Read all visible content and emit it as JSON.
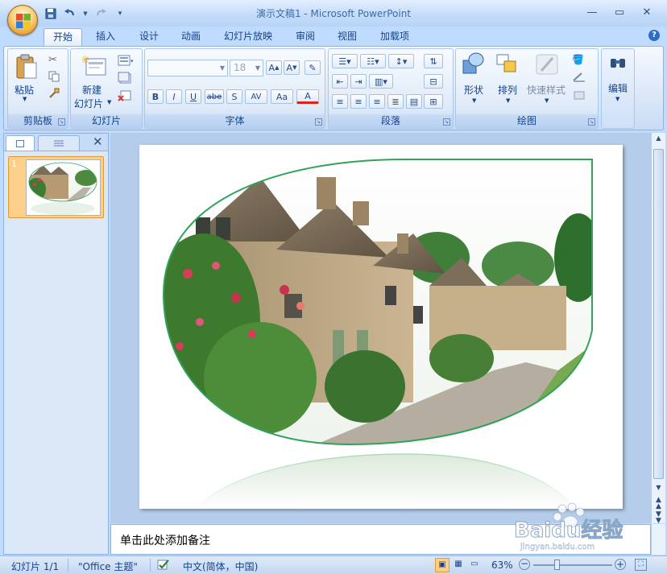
{
  "window": {
    "title": "演示文稿1 - Microsoft PowerPoint"
  },
  "quick_access": {
    "icons": [
      "save-icon",
      "undo-icon",
      "redo-icon",
      "customize-icon"
    ]
  },
  "tabs": [
    {
      "label": "开始",
      "active": true
    },
    {
      "label": "插入"
    },
    {
      "label": "设计"
    },
    {
      "label": "动画"
    },
    {
      "label": "幻灯片放映"
    },
    {
      "label": "审阅"
    },
    {
      "label": "视图"
    },
    {
      "label": "加载项"
    }
  ],
  "ribbon": {
    "clipboard": {
      "label": "剪贴板",
      "paste": "粘贴"
    },
    "slides": {
      "label": "幻灯片",
      "new_slide_line1": "新建",
      "new_slide_line2": "幻灯片"
    },
    "font": {
      "label": "字体",
      "size": "18",
      "buttons": [
        "B",
        "I",
        "U",
        "abe",
        "S",
        "AV",
        "Aa",
        "A"
      ]
    },
    "paragraph": {
      "label": "段落"
    },
    "drawing": {
      "label": "绘图",
      "shapes": "形状",
      "arrange": "排列",
      "quick_styles": "快速样式"
    },
    "editing": {
      "label": "编辑"
    }
  },
  "slide_panel": {
    "number": "1"
  },
  "notes": {
    "placeholder": "单击此处添加备注"
  },
  "status": {
    "slide": "幻灯片 1/1",
    "theme": "\"Office 主题\"",
    "language": "中文(简体，中国)",
    "zoom": "63%"
  },
  "watermark": {
    "text": "Baidu经验",
    "url": "jingyan.baidu.com"
  },
  "colors": {
    "accent": "#15428b",
    "ribbon_bg": "#bfdbff",
    "selected_thumb": "#fcd08a",
    "oval_border": "#2fa35a"
  }
}
